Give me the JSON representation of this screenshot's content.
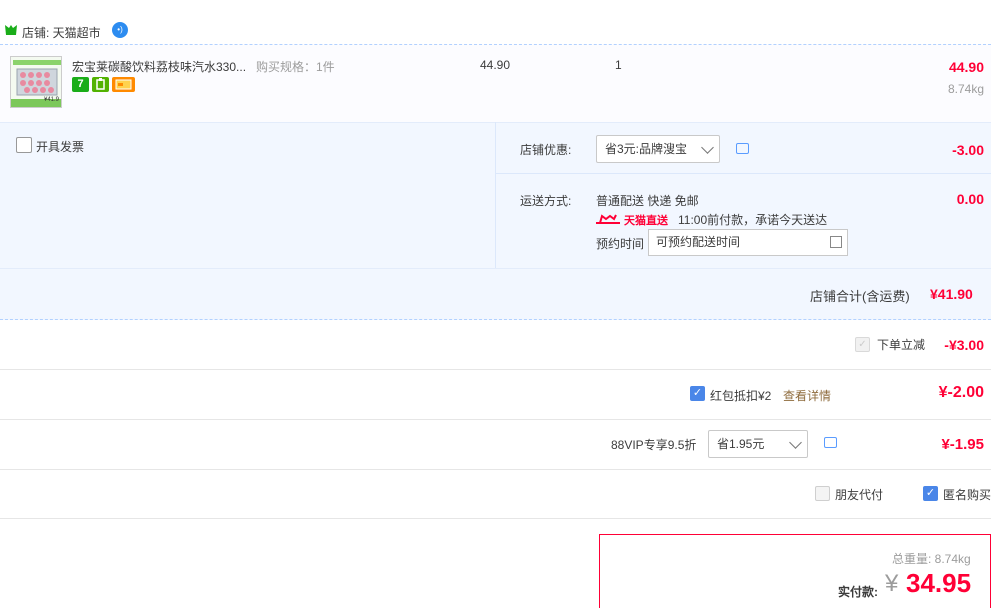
{
  "shop": {
    "label": "店铺: 天猫超市",
    "wangwang_icon": "chat-bubble-icon"
  },
  "item": {
    "title": "宏宝莱碳酸饮料荔枝味汽水330...",
    "spec": "购买规格：1件",
    "unit_price": "44.90",
    "quantity": "1",
    "subtotal": "44.90",
    "weight": "8.74kg",
    "badges": [
      {
        "icon": "seven-day-return-icon",
        "text": "7",
        "color": "#1aad19"
      },
      {
        "icon": "quality-guarantee-icon",
        "text": "",
        "color": "#52b202"
      },
      {
        "icon": "card-payment-icon",
        "text": "",
        "color": "#ff8a00"
      }
    ],
    "thumb_label": "¥41.9"
  },
  "options": {
    "invoice_label": "开具发票",
    "shop_discount_label": "店铺优惠:",
    "shop_discount_select": "省3元:品牌溲宝",
    "shop_discount_amount": "-3.00",
    "shipping_label": "运送方式:",
    "shipping_method": "普通配送 快递 免邮",
    "tmall_direct": "天猫直送",
    "promise": "11:00前付款，承诺今天送达",
    "appointment_label": "预约时间",
    "appointment_value": "可预约配送时间",
    "shipping_amount": "0.00"
  },
  "shop_total": {
    "label": "店铺合计(含运费)",
    "value": "¥41.90"
  },
  "instant_discount": {
    "label": "下单立减",
    "value": "-¥3.00"
  },
  "red_packet": {
    "label": "红包抵扣¥2",
    "link": "查看详情",
    "value": "¥-2.00"
  },
  "vip": {
    "label": "88VIP专享9.5折",
    "select": "省1.95元",
    "value": "¥-1.95"
  },
  "extras": {
    "friend_pay": "朋友代付",
    "anonymous": "匿名购买"
  },
  "summary": {
    "weight_text": "总重量: 8.74kg",
    "pay_label": "实付款:",
    "currency": "¥",
    "pay_value": "34.95"
  },
  "colors": {
    "price_red": "#ff0036",
    "accent_blue": "#4a86e8",
    "panel_bg": "#f2f7ff"
  }
}
